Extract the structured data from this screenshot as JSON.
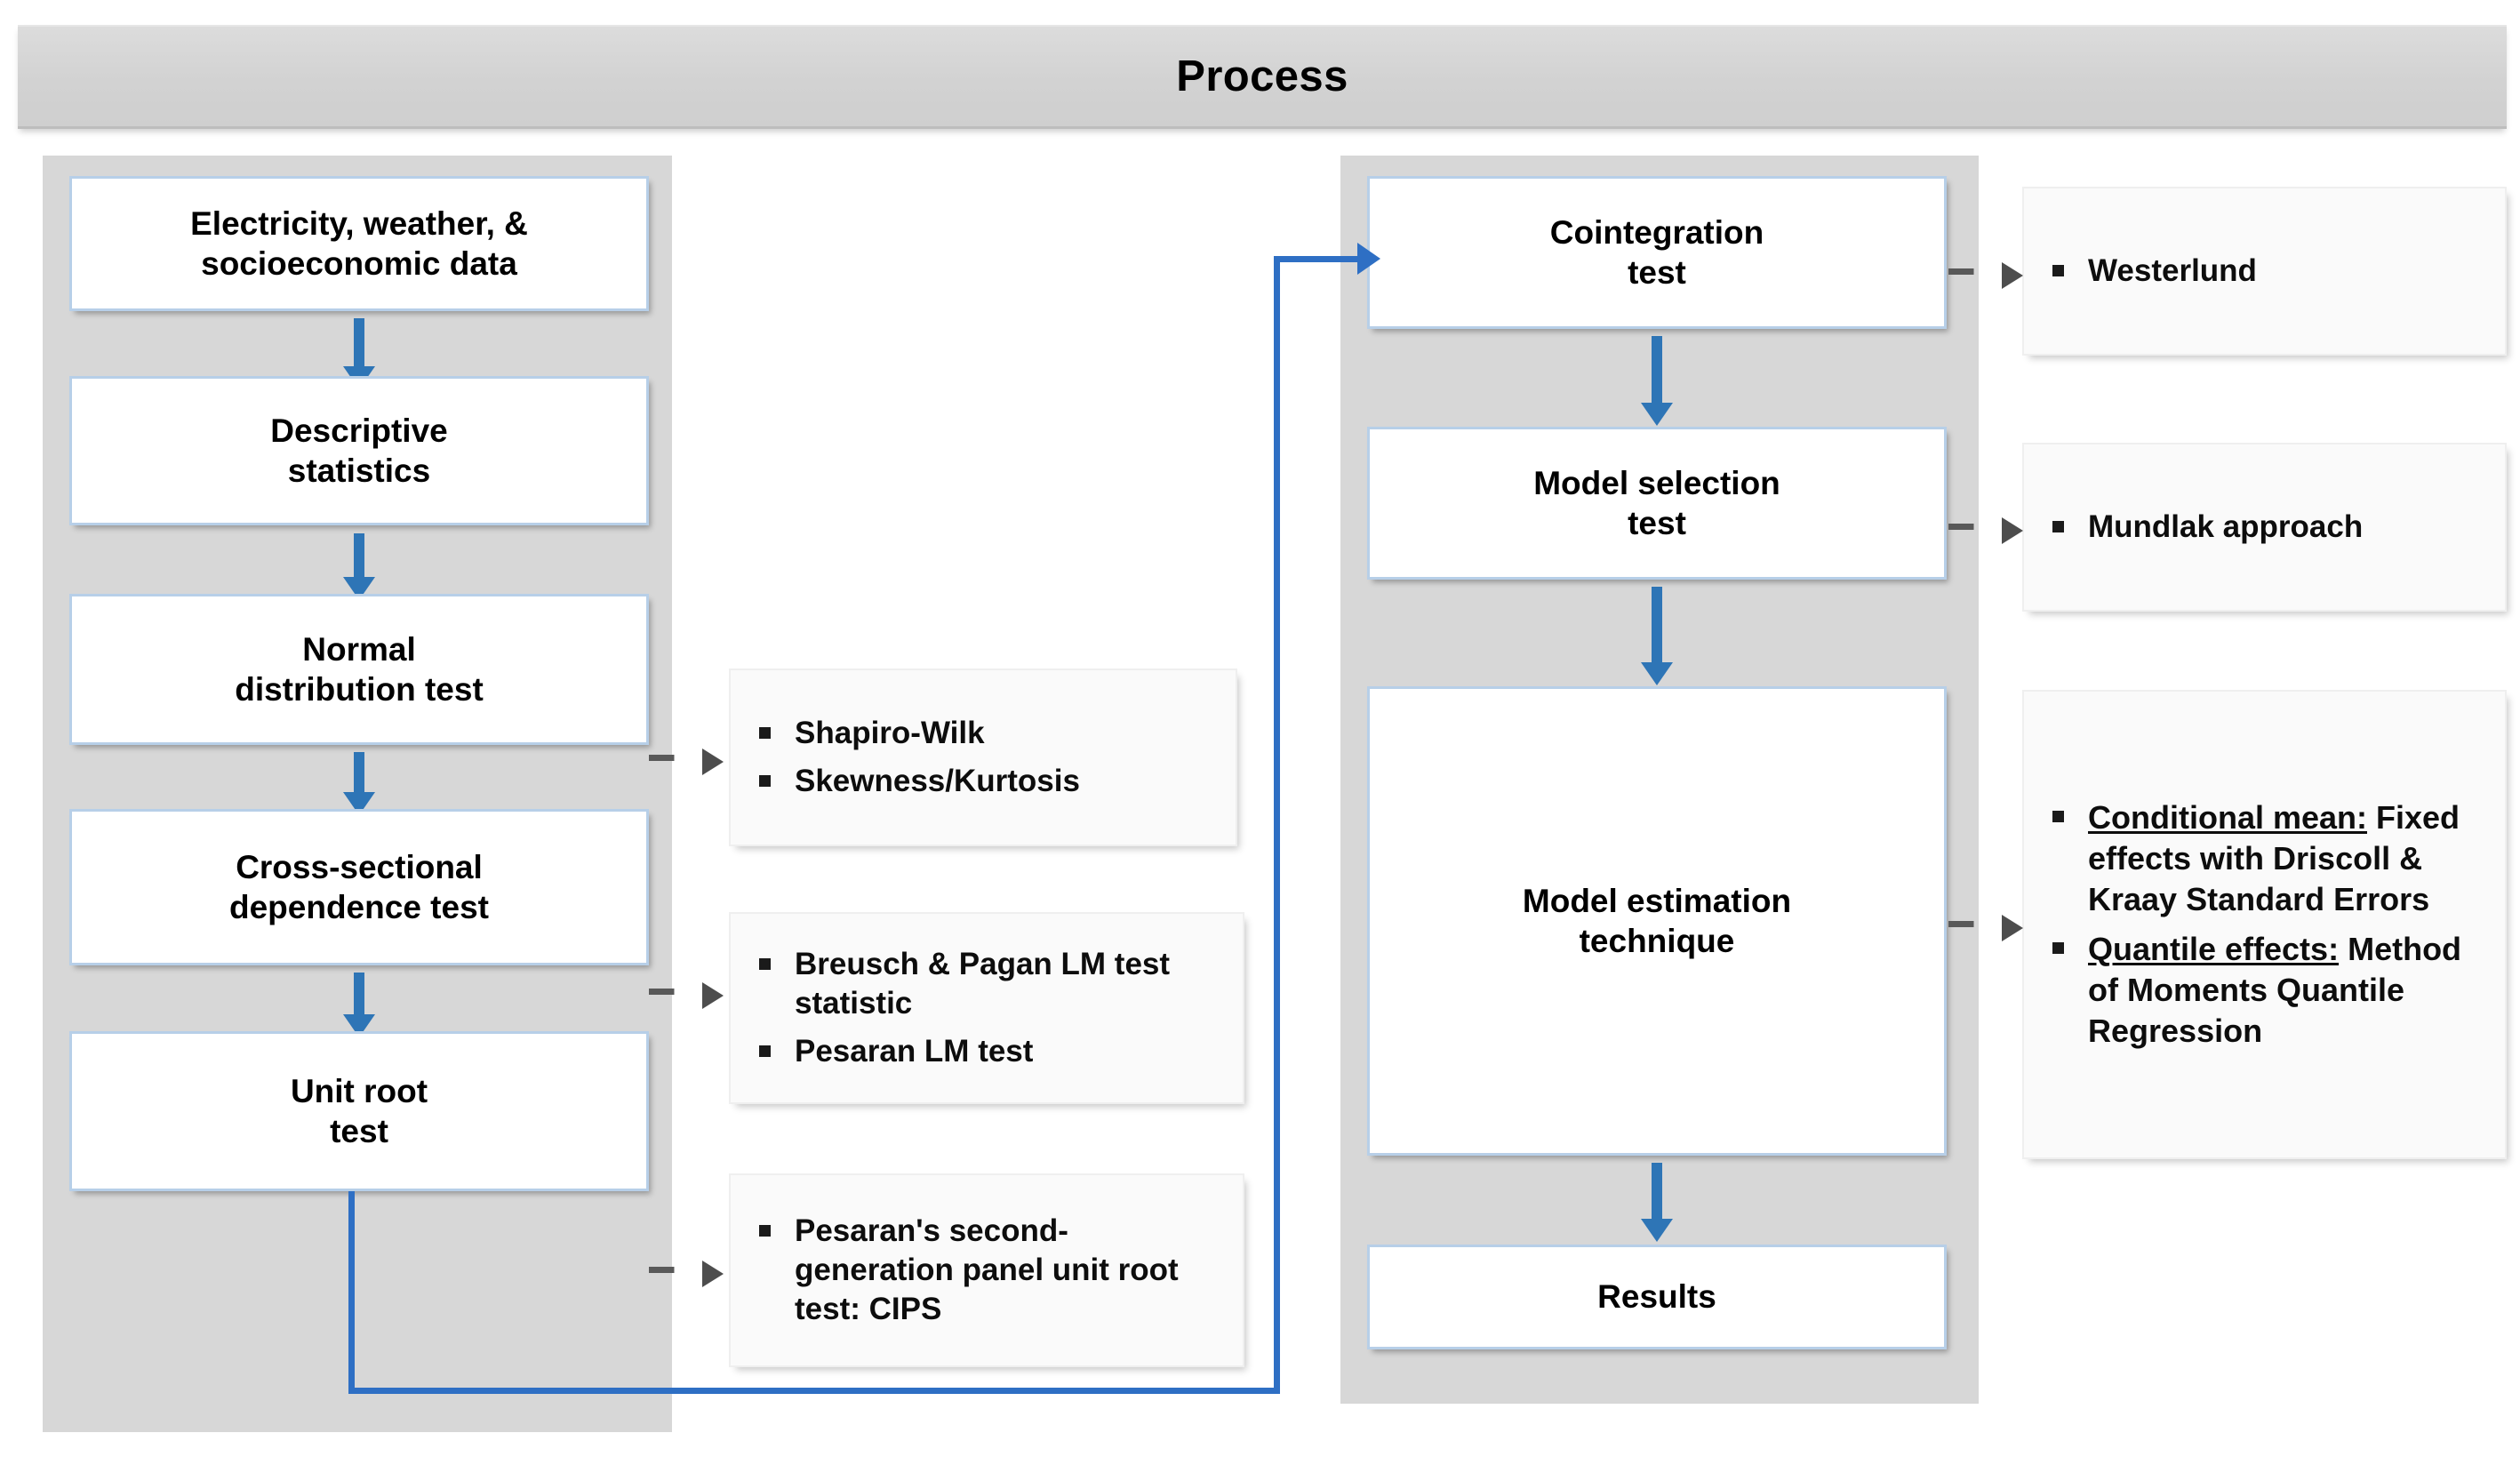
{
  "header": {
    "title": "Process"
  },
  "left_panel": {
    "steps": [
      {
        "id": "data",
        "label": "Electricity, weather, &\nsocioeconomic data"
      },
      {
        "id": "desc",
        "label": "Descriptive\nstatistics"
      },
      {
        "id": "normal",
        "label": "Normal\ndistribution test"
      },
      {
        "id": "csd",
        "label": "Cross-sectional\ndependence test"
      },
      {
        "id": "unit",
        "label": "Unit root\ntest"
      }
    ]
  },
  "right_panel": {
    "steps": [
      {
        "id": "coint",
        "label": "Cointegration\ntest"
      },
      {
        "id": "msel",
        "label": "Model selection\ntest"
      },
      {
        "id": "mest",
        "label": "Model estimation\ntechnique"
      },
      {
        "id": "results",
        "label": "Results"
      }
    ]
  },
  "notes": {
    "normal": {
      "items": [
        {
          "lead": "",
          "body": "Shapiro-Wilk"
        },
        {
          "lead": "",
          "body": "Skewness/Kurtosis"
        }
      ]
    },
    "csd": {
      "items": [
        {
          "lead": "",
          "body": "Breusch & Pagan LM test statistic"
        },
        {
          "lead": "",
          "body": "Pesaran LM test"
        }
      ]
    },
    "unit": {
      "items": [
        {
          "lead": "",
          "body": "Pesaran's second-generation panel unit root test: CIPS"
        }
      ]
    },
    "coint": {
      "items": [
        {
          "lead": "",
          "body": "Westerlund"
        }
      ]
    },
    "msel": {
      "items": [
        {
          "lead": "",
          "body": "Mundlak approach"
        }
      ]
    },
    "mest": {
      "items": [
        {
          "lead": "Conditional mean:",
          "body": "Fixed effects with Driscoll & Kraay Standard Errors"
        },
        {
          "lead": "Quantile effects:",
          "body": "Method of Moments Quantile Regression"
        }
      ]
    }
  },
  "colors": {
    "panel_gray": "#d7d7d7",
    "header_gray": "#d9d9d9",
    "box_border_blue": "#b7cfe8",
    "arrow_blue": "#2e75b6",
    "feedback_blue": "#2e6fc4",
    "dashed_gray": "#595959"
  }
}
